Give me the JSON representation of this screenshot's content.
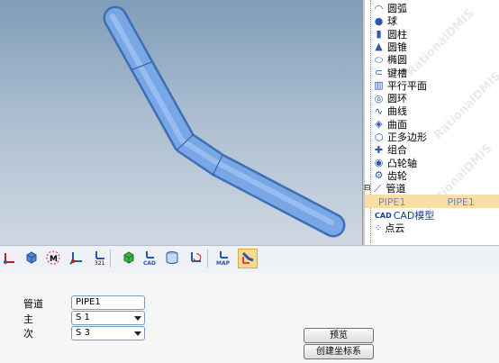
{
  "tree": {
    "items": [
      {
        "label": "圆弧",
        "icon": "arc-icon"
      },
      {
        "label": "球",
        "icon": "sphere-icon"
      },
      {
        "label": "圆柱",
        "icon": "cylinder-icon"
      },
      {
        "label": "圆锥",
        "icon": "cone-icon"
      },
      {
        "label": "椭圆",
        "icon": "ellipse-icon"
      },
      {
        "label": "键槽",
        "icon": "slot-icon"
      },
      {
        "label": "平行平面",
        "icon": "parallel-planes-icon"
      },
      {
        "label": "圆环",
        "icon": "torus-icon"
      },
      {
        "label": "曲线",
        "icon": "curve-icon"
      },
      {
        "label": "曲面",
        "icon": "surface-icon"
      },
      {
        "label": "正多边形",
        "icon": "polygon-icon"
      },
      {
        "label": "组合",
        "icon": "combination-icon"
      },
      {
        "label": "凸轮轴",
        "icon": "camshaft-icon"
      },
      {
        "label": "齿轮",
        "icon": "gear-icon"
      },
      {
        "label": "管道",
        "icon": "pipe-icon"
      }
    ],
    "selected": {
      "name": "PIPE1",
      "value": "PIPE1"
    },
    "cad_label": "CAD模型",
    "cad_icon_text": "CAD",
    "pointcloud_label": "点云",
    "watermark": "RationalDMIS"
  },
  "toolbar": {
    "icons": [
      "origin-axes-icon",
      "cube-icon",
      "target-m-icon",
      "axes-icon",
      "axes-321-icon",
      "green-cube-icon",
      "cad-align-icon",
      "cylinder-align-icon",
      "axes-rotate-icon",
      "axes-map-icon",
      "pipe-align-icon"
    ],
    "map_text": "MAP",
    "cad_text": "CAD",
    "n321_text": "321",
    "m_text": "M"
  },
  "form": {
    "pipe_label": "管道",
    "pipe_value": "PIPE1",
    "primary_label": "主",
    "primary_value": "S 1",
    "secondary_label": "次",
    "secondary_value": "S 3",
    "preview_button": "预览",
    "create_button": "创建坐标系"
  },
  "colors": {
    "pipe": "#6f9ee0",
    "selection": "#f8dfa5"
  }
}
